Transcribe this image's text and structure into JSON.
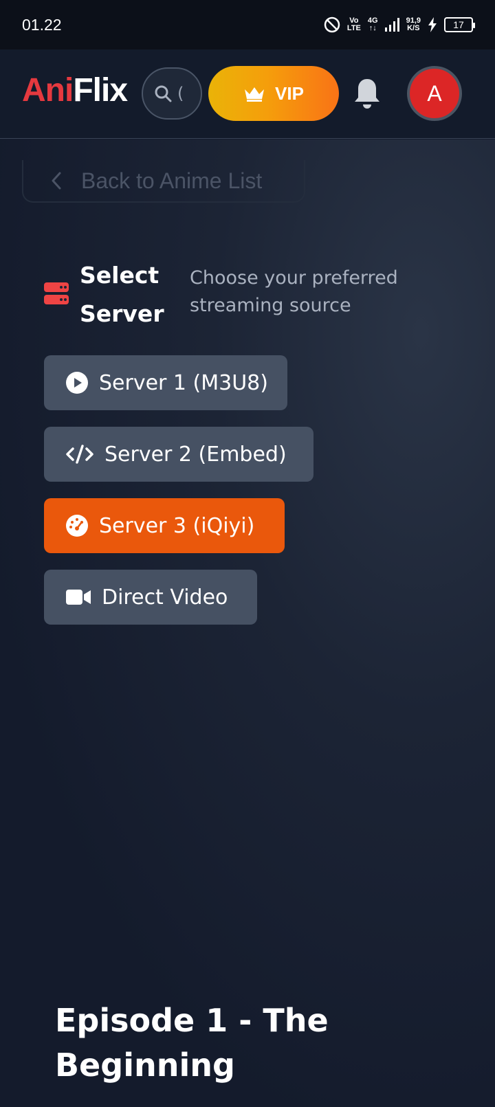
{
  "status_bar": {
    "time": "01.22",
    "volte_top": "Vo",
    "volte_bottom": "LTE",
    "network": "4G",
    "speed_value": "91,9",
    "speed_unit": "K/S",
    "battery": "17"
  },
  "header": {
    "logo_part1": "Ani",
    "logo_part2": "Flix",
    "search_placeholder": "(",
    "vip_label": "VIP",
    "avatar_letter": "A"
  },
  "nav": {
    "back_label": "Back to Anime List"
  },
  "server_section": {
    "title_line1": "Select",
    "title_line2": "Server",
    "subtitle": "Choose your preferred streaming source",
    "servers": [
      {
        "label": "Server 1 (M3U8)",
        "icon": "play-circle-icon",
        "active": false
      },
      {
        "label": "Server 2 (Embed)",
        "icon": "code-icon",
        "active": false
      },
      {
        "label": "Server 3 (iQiyi)",
        "icon": "gauge-icon",
        "active": true
      },
      {
        "label": "Direct Video",
        "icon": "video-camera-icon",
        "active": false
      }
    ]
  },
  "episode": {
    "title": "Episode 1 - The Beginning"
  },
  "colors": {
    "brand_red": "#e5393f",
    "active_server": "#ea580c",
    "server_button": "#465163",
    "vip_gradient_start": "#eab308",
    "vip_gradient_end": "#f97316"
  }
}
